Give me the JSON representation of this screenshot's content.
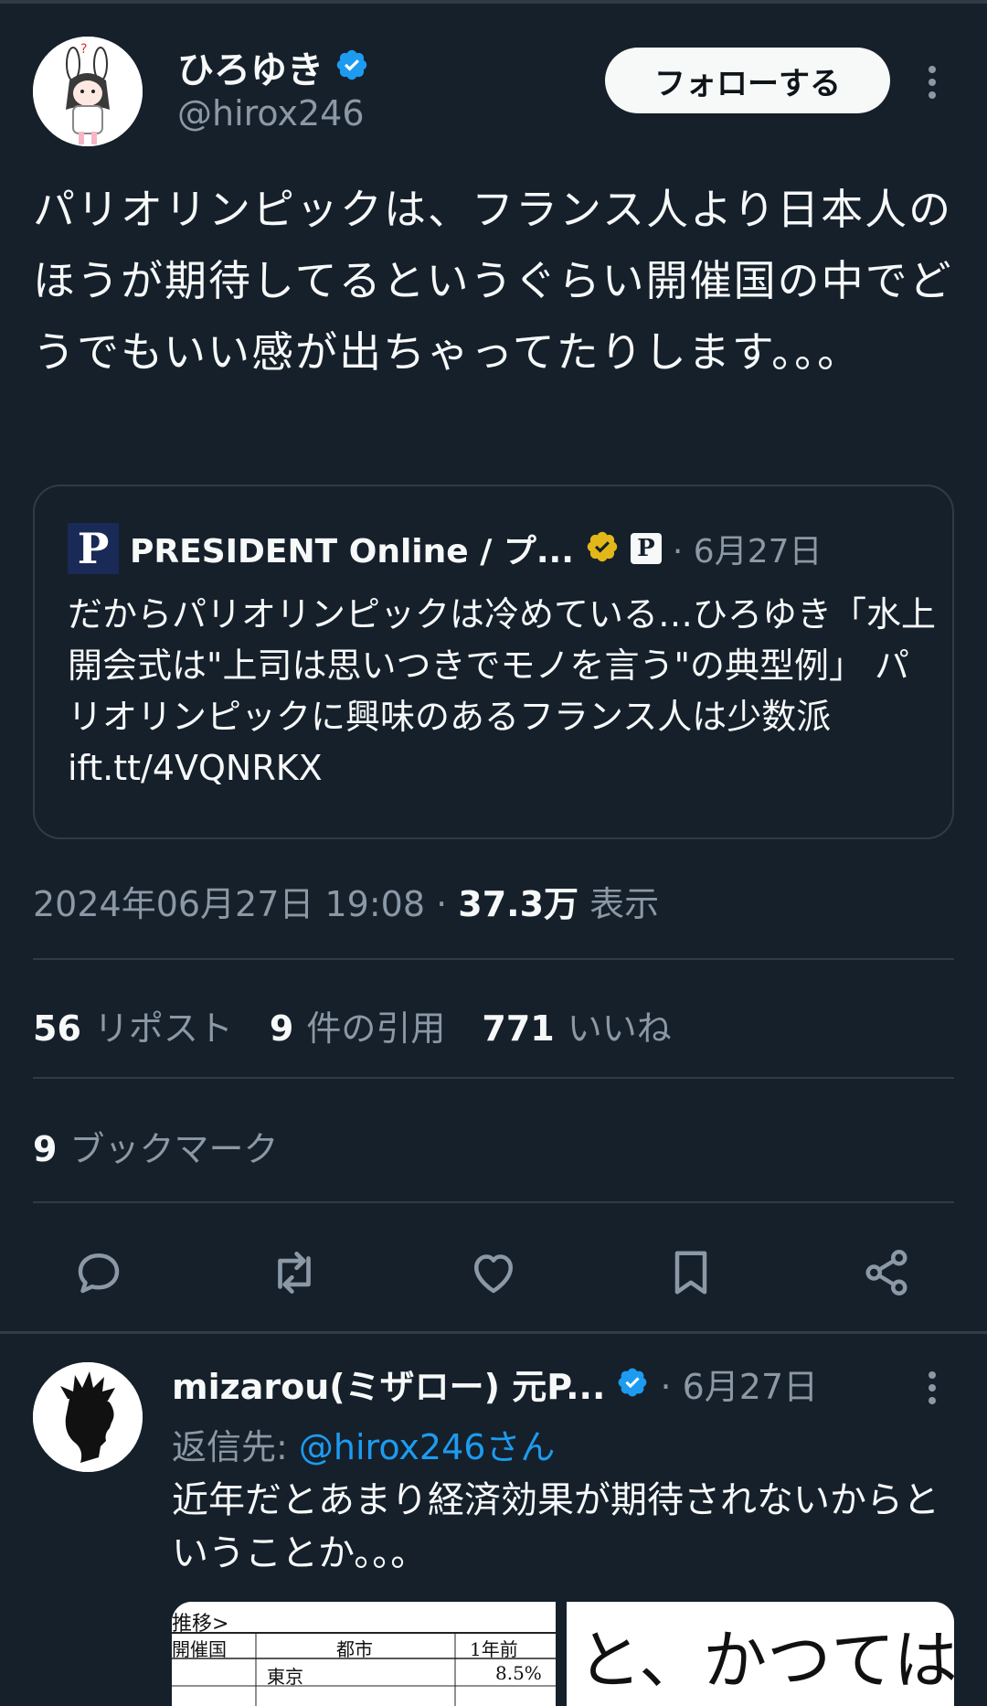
{
  "tweet": {
    "author": {
      "display_name": "ひろゆき",
      "handle": "@hirox246"
    },
    "follow_label": "フォローする",
    "text": "パリオリンピックは、フランス人より日本人のほうが期待してるというぐらい開催国の中でどうでもいい感が出ちゃってたりします。。。",
    "quote": {
      "name": "PRESIDENT Online / プ...",
      "logo_letter": "P",
      "badge_letter": "P",
      "date": "· 6月27日",
      "text": "だからパリオリンピックは冷めている…ひろゆき「水上開会式は\"上司は思いつきでモノを言う\"の典型例」 パリオリンピックに興味のあるフランス人は少数派 ift.tt/4VQNRKX"
    },
    "timestamp": "2024年06月27日 19:08 · ",
    "views_count": "37.3万",
    "views_label": "表示",
    "stats": {
      "reposts_count": "56",
      "reposts_label": "リポスト",
      "quotes_count": "9",
      "quotes_label": "件の引用",
      "likes_count": "771",
      "likes_label": "いいね",
      "bookmarks_count": "9",
      "bookmarks_label": "ブックマーク"
    }
  },
  "reply": {
    "author": {
      "display_name": "mizarou(ミザロー) 元P..."
    },
    "date": "· 6月27日",
    "reply_to_label": "返信先: ",
    "reply_to_mention": "@hirox246さん",
    "text": "近年だとあまり経済効果が期待されないからということか。。。",
    "media_left": {
      "caption": "推移>",
      "col1": "開催国",
      "col2": "都市",
      "col3": "1年前",
      "cell_city": "東京",
      "cell_value": "8.5%"
    },
    "media_right_text": "と、かつては"
  },
  "icons": [
    "verified-badge-icon",
    "gold-verified-badge-icon",
    "more-icon",
    "reply-icon",
    "repost-icon",
    "like-icon",
    "bookmark-icon",
    "share-icon"
  ],
  "colors": {
    "background": "#15202b",
    "text": "#f7f9f9",
    "muted": "#8b98a5",
    "accent": "#1d9bf0",
    "verified": "#1d9bf0",
    "gold": "#e2b719",
    "divider": "#2f3b47"
  }
}
